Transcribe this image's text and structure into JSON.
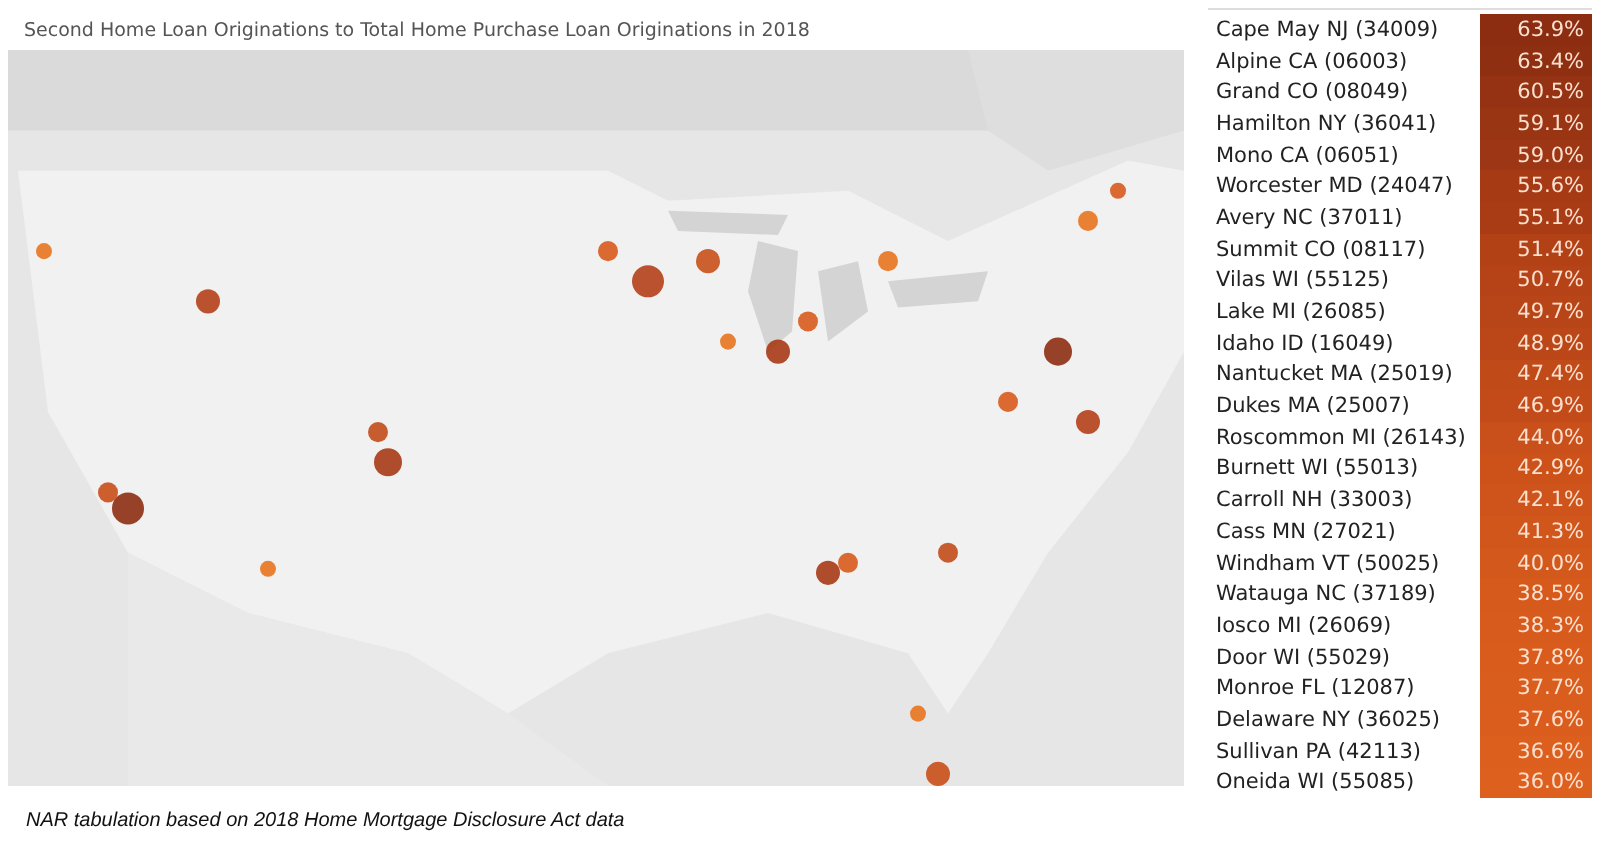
{
  "map": {
    "title": "Second Home Loan Originations to Total Home Purchase Loan Originations in 2018",
    "kind": "picture"
  },
  "table": {
    "rows": [
      {
        "county": "Cape May NJ (34009)",
        "share": "63.9%",
        "color": "#8c2d12"
      },
      {
        "county": "Alpine CA (06003)",
        "share": "63.4%",
        "color": "#8f2f12"
      },
      {
        "county": "Grand CO (08049)",
        "share": "60.5%",
        "color": "#953213"
      },
      {
        "county": "Hamilton NY (36041)",
        "share": "59.1%",
        "color": "#9a3513"
      },
      {
        "county": "Mono CA (06051)",
        "share": "59.0%",
        "color": "#9c3614"
      },
      {
        "county": "Worcester MD (24047)",
        "share": "55.6%",
        "color": "#a63a15"
      },
      {
        "county": "Avery NC (37011)",
        "share": "55.1%",
        "color": "#a93c15"
      },
      {
        "county": "Summit CO (08117)",
        "share": "51.4%",
        "color": "#b24116"
      },
      {
        "county": "Vilas WI (55125)",
        "share": "50.7%",
        "color": "#b54317"
      },
      {
        "county": "Lake MI (26085)",
        "share": "49.7%",
        "color": "#b84517"
      },
      {
        "county": "Idaho ID (16049)",
        "share": "48.9%",
        "color": "#bb4718"
      },
      {
        "county": "Nantucket MA (25019)",
        "share": "47.4%",
        "color": "#c04a18"
      },
      {
        "county": "Dukes MA (25007)",
        "share": "46.9%",
        "color": "#c24b19"
      },
      {
        "county": "Roscommon MI (26143)",
        "share": "44.0%",
        "color": "#c9501a"
      },
      {
        "county": "Burnett WI (55013)",
        "share": "42.9%",
        "color": "#cc521a"
      },
      {
        "county": "Carroll NH (33003)",
        "share": "42.1%",
        "color": "#ce541b"
      },
      {
        "county": "Cass MN (27021)",
        "share": "41.3%",
        "color": "#d0561b"
      },
      {
        "county": "Windham VT (50025)",
        "share": "40.0%",
        "color": "#d3581c"
      },
      {
        "county": "Watauga NC (37189)",
        "share": "38.5%",
        "color": "#d65a1c"
      },
      {
        "county": "Iosco MI (26069)",
        "share": "38.3%",
        "color": "#d75b1c"
      },
      {
        "county": "Door WI (55029)",
        "share": "37.8%",
        "color": "#d95c1d"
      },
      {
        "county": "Monroe FL (12087)",
        "share": "37.7%",
        "color": "#d95d1d"
      },
      {
        "county": "Delaware NY (36025)",
        "share": "37.6%",
        "color": "#da5d1d"
      },
      {
        "county": "Sullivan PA (42113)",
        "share": "36.6%",
        "color": "#dc5f1d"
      },
      {
        "county": "Oneida WI (55085)",
        "share": "36.0%",
        "color": "#de601e"
      }
    ]
  },
  "footnote": "NAR tabulation based on 2018 Home Mortgage Disclosure Act data"
}
